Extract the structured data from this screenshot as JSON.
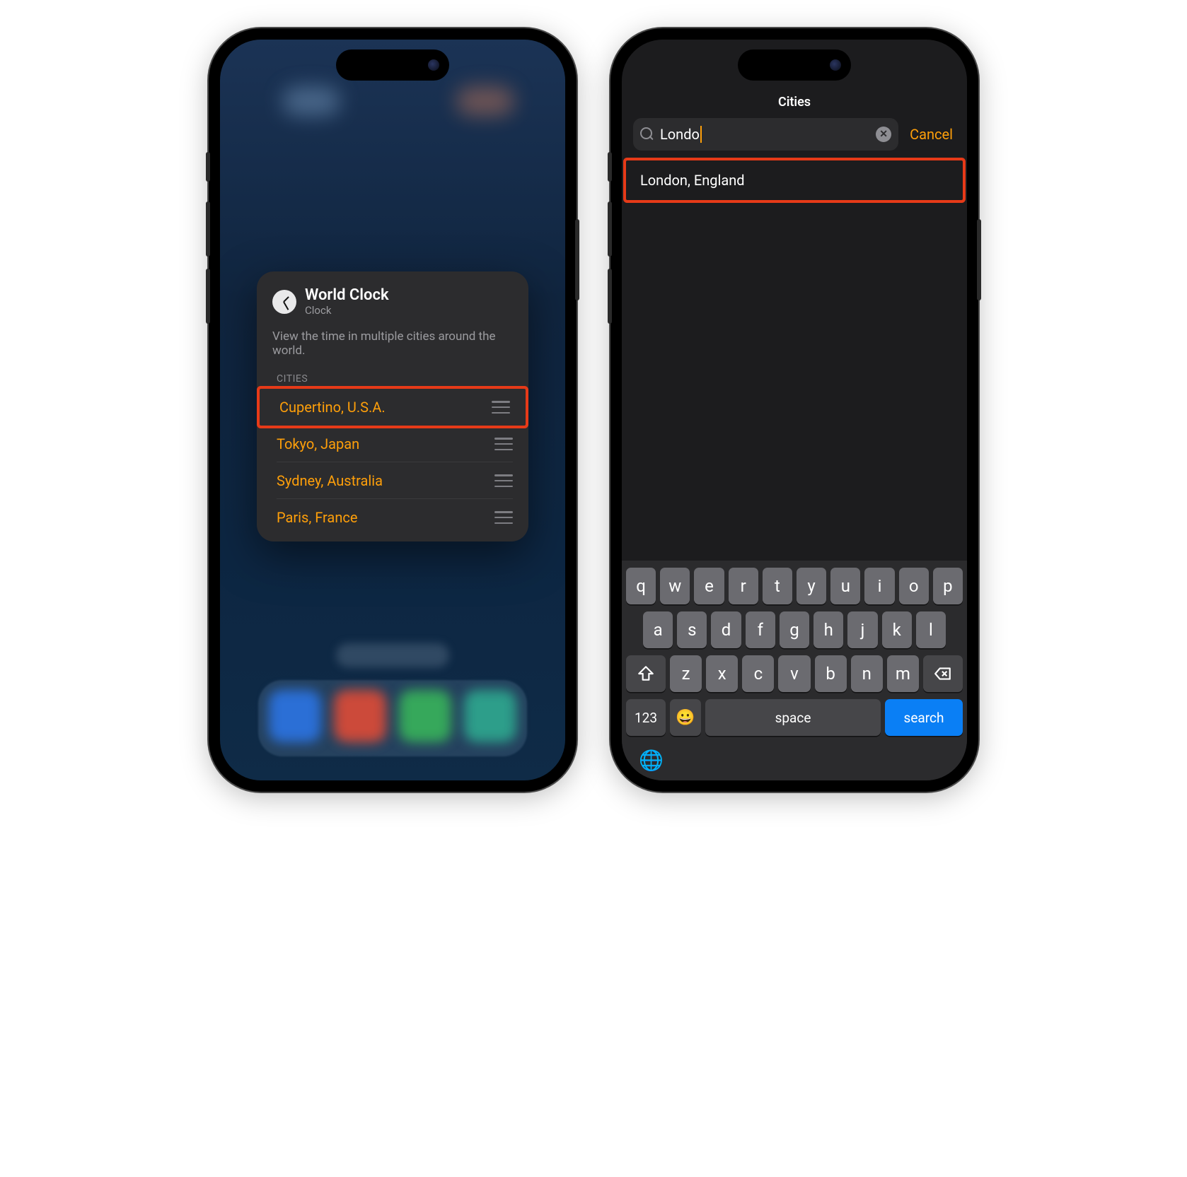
{
  "phone1": {
    "widget": {
      "title": "World Clock",
      "subtitle": "Clock",
      "description": "View the time in multiple cities around the world.",
      "section_label": "CITIES",
      "cities": [
        "Cupertino, U.S.A.",
        "Tokyo, Japan",
        "Sydney, Australia",
        "Paris, France"
      ],
      "highlighted_index": 0
    }
  },
  "phone2": {
    "nav_title": "Cities",
    "search": {
      "value": "Londo",
      "clear_glyph": "✕"
    },
    "cancel_label": "Cancel",
    "results": [
      "London, England"
    ],
    "highlighted_result_index": 0,
    "keyboard": {
      "row1": [
        "q",
        "w",
        "e",
        "r",
        "t",
        "y",
        "u",
        "i",
        "o",
        "p"
      ],
      "row2": [
        "a",
        "s",
        "d",
        "f",
        "g",
        "h",
        "j",
        "k",
        "l"
      ],
      "row3": [
        "z",
        "x",
        "c",
        "v",
        "b",
        "n",
        "m"
      ],
      "num_key": "123",
      "emoji": "😀",
      "space_label": "space",
      "search_label": "search",
      "globe": "🌐"
    }
  }
}
